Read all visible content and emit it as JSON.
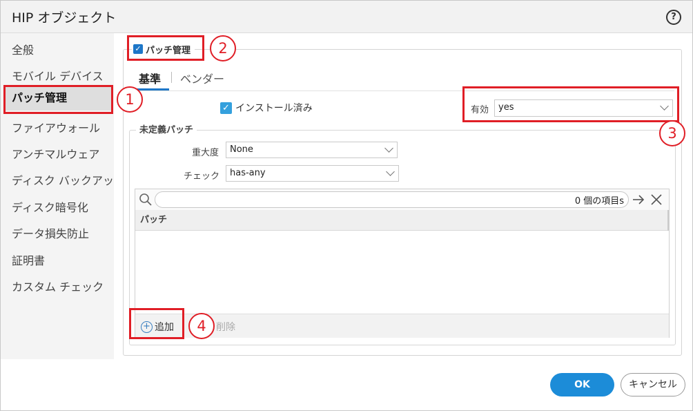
{
  "dialog": {
    "title": "HIP オブジェクト",
    "help_icon": "question-circle-icon"
  },
  "sidebar": {
    "items": [
      {
        "label": "全般"
      },
      {
        "label": "モバイル デバイス"
      },
      {
        "label": "パッチ管理",
        "active": true
      },
      {
        "label": "ファイアウォール"
      },
      {
        "label": "アンチマルウェア"
      },
      {
        "label": "ディスク バックアップ"
      },
      {
        "label": "ディスク暗号化"
      },
      {
        "label": "データ損失防止"
      },
      {
        "label": "証明書"
      },
      {
        "label": "カスタム チェック"
      }
    ]
  },
  "section": {
    "checkbox_label": "パッチ管理",
    "checked": true
  },
  "tabs": [
    {
      "label": "基準",
      "active": true
    },
    {
      "label": "ベンダー"
    }
  ],
  "criteria": {
    "installed_label": "インストール済み",
    "installed_checked": true,
    "enabled_label": "有効",
    "enabled_value": "yes"
  },
  "missing_patches": {
    "legend": "未定義パッチ",
    "severity_label": "重大度",
    "severity_value": "None",
    "check_label": "チェック",
    "check_value": "has-any",
    "item_count": "0 個の項目s",
    "column_header": "パッチ",
    "add_label": "追加",
    "delete_label": "削除"
  },
  "buttons": {
    "ok": "OK",
    "cancel": "キャンセル"
  },
  "annotations": {
    "callouts": [
      "1",
      "2",
      "3",
      "4"
    ],
    "highlight_color": "#e01e26"
  },
  "colors": {
    "accent": "#1c8cd8",
    "checkbox": "#1e77c8"
  }
}
